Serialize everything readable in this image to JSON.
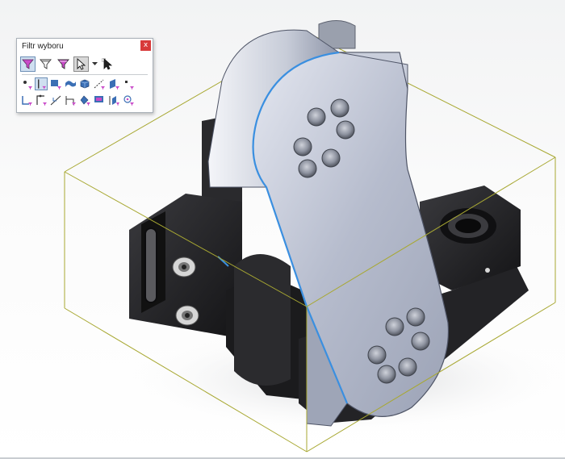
{
  "window": {
    "background": "#f6f7f8"
  },
  "selection_filter": {
    "title": "Filtr wyboru",
    "close_label": "x",
    "toolbar_row": [
      {
        "name": "toggle-filter-icon",
        "state": "pressed"
      },
      {
        "name": "clear-filters-icon",
        "state": "normal"
      },
      {
        "name": "select-all-filters-icon",
        "state": "normal"
      },
      {
        "name": "select-pointer-icon",
        "state": "pressed-gray"
      },
      {
        "name": "dropdown-arrow-icon",
        "state": "normal"
      },
      {
        "name": "select-other-pointer-icon",
        "state": "normal"
      }
    ],
    "filter_row_1": [
      "filter-vertices-icon",
      "filter-edges-icon",
      "filter-faces-icon",
      "filter-surface-bodies-icon",
      "filter-solid-bodies-icon",
      "filter-axes-icon",
      "filter-planes-icon",
      "filter-sketch-points-icon"
    ],
    "filter_row_2": [
      "filter-sketch-segments-icon",
      "filter-midpoints-icon",
      "filter-center-marks-icon",
      "filter-dimensions-icon",
      "filter-surface-finish-icon",
      "filter-annotations-icon",
      "filter-weld-symbols-icon",
      "filter-datum-targets-icon"
    ],
    "active_filter": "filter-edges-icon",
    "accent": "#c94ac9"
  },
  "model": {
    "body_color": "#1f1f21",
    "link_color": "#b9bfd0",
    "selection_color": "#3a8fe0",
    "bounding_box_color": "#a8a832"
  }
}
